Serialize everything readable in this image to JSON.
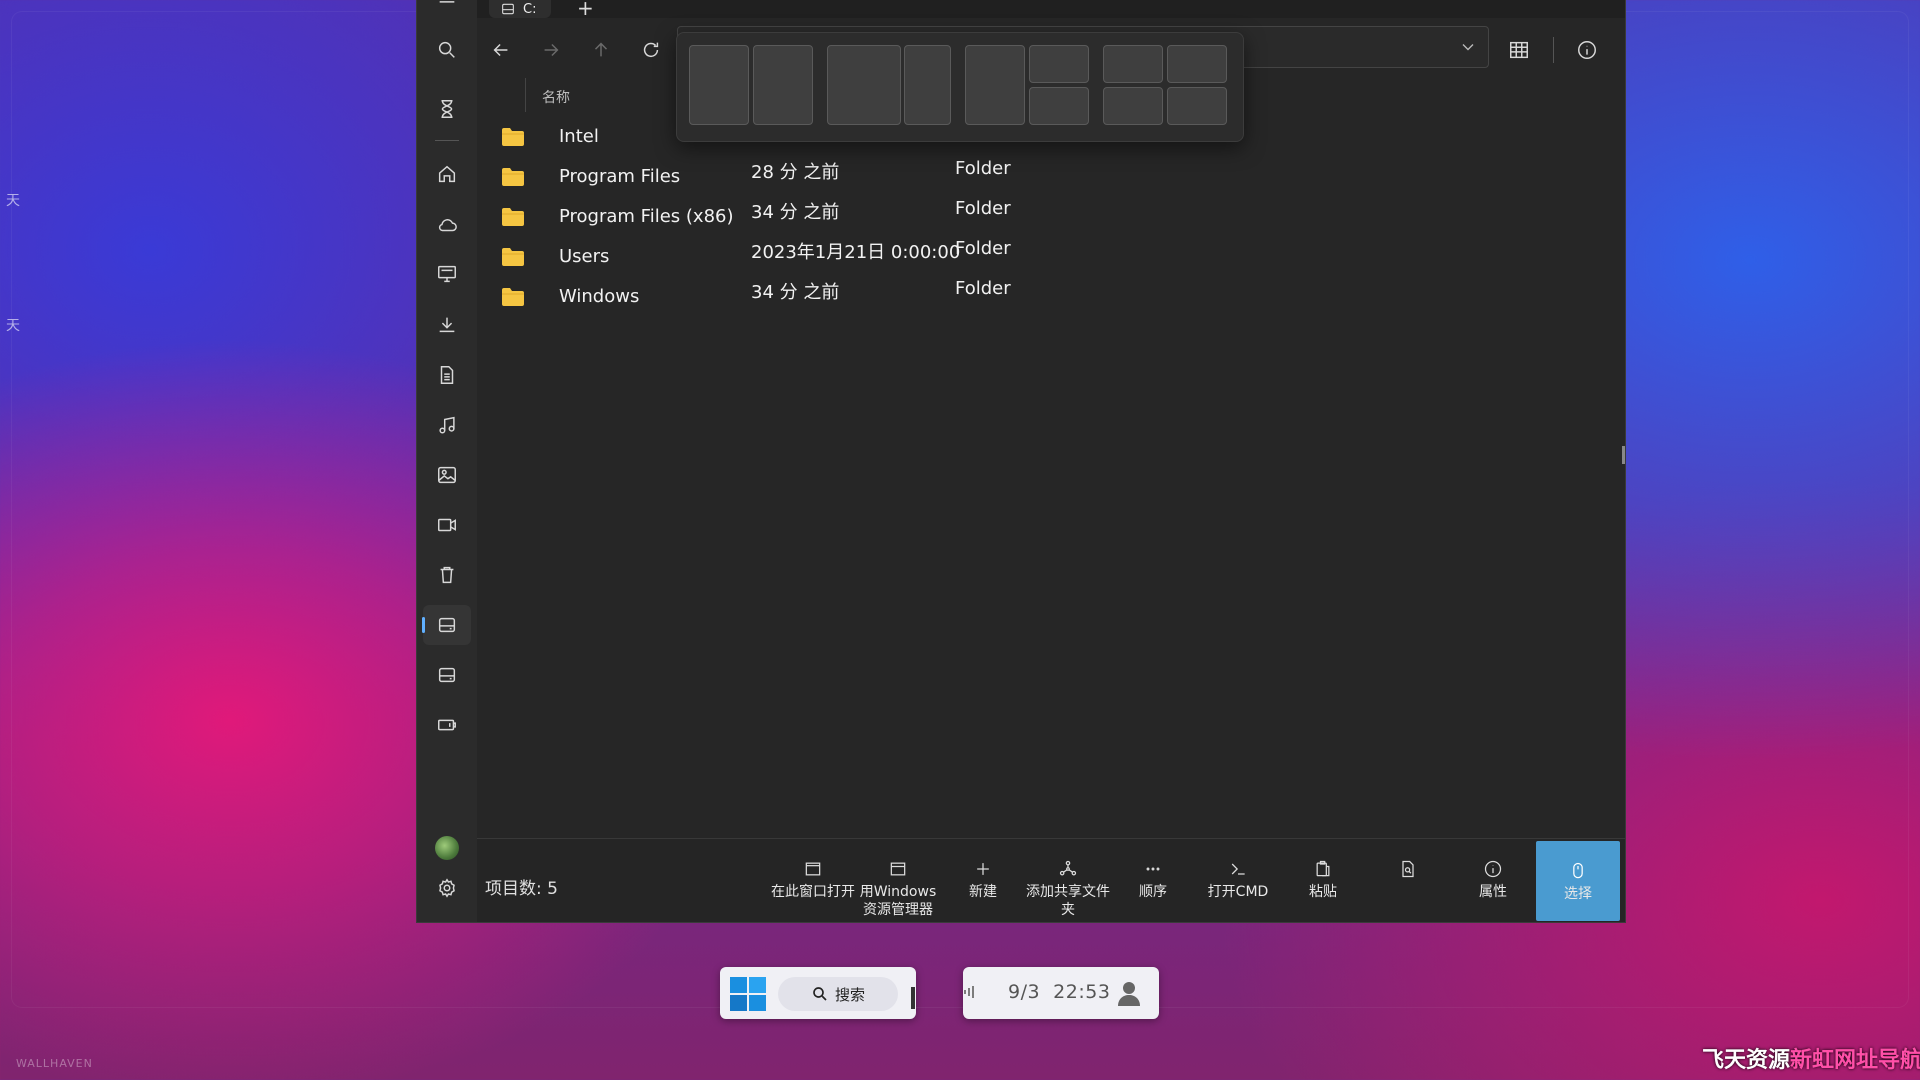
{
  "window": {
    "tab_title": "C:",
    "new_tab_label": "+",
    "column_name": "名称",
    "items": [
      {
        "name": "Intel",
        "date": "",
        "type": ""
      },
      {
        "name": "Program Files",
        "date": "28 分 之前",
        "type": "Folder"
      },
      {
        "name": "Program Files (x86)",
        "date": "34 分 之前",
        "type": "Folder"
      },
      {
        "name": "Users",
        "date": "2023年1月21日 0:00:00",
        "type": "Folder"
      },
      {
        "name": "Windows",
        "date": "34 分 之前",
        "type": "Folder"
      }
    ],
    "status": {
      "item_count": "项目数: 5"
    },
    "commands": {
      "open_here": "在此窗口打开",
      "open_explorer": "用Windows资源管理器",
      "new": "新建",
      "add_share": "添加共享文件夹",
      "sort": "顺序",
      "open_cmd": "打开CMD",
      "paste": "粘贴",
      "properties": "属性",
      "select": "选择"
    }
  },
  "sidebar": {
    "icons": [
      "search-icon",
      "hourglass-icon",
      "home-icon",
      "cloud-icon",
      "desktop-icon",
      "download-icon",
      "document-icon",
      "music-icon",
      "image-icon",
      "video-icon",
      "recycle-bin-icon",
      "drive-icon",
      "drive-icon",
      "external-drive-icon",
      "avatar",
      "settings-icon"
    ],
    "active": "drive-c"
  },
  "taskbar": {
    "search_label": "搜索",
    "date": "9/3",
    "time": "22:53"
  },
  "desktop": {
    "wallpaper_credit": "WALLHAVEN",
    "watermark_prefix": "飞天资源",
    "watermark_accent": "新虹网址导航",
    "edge_chars": [
      "天",
      "天"
    ]
  },
  "colors": {
    "accent": "#4a9bd0",
    "folder": "#f5c542",
    "active_indicator": "#60b0ff"
  }
}
